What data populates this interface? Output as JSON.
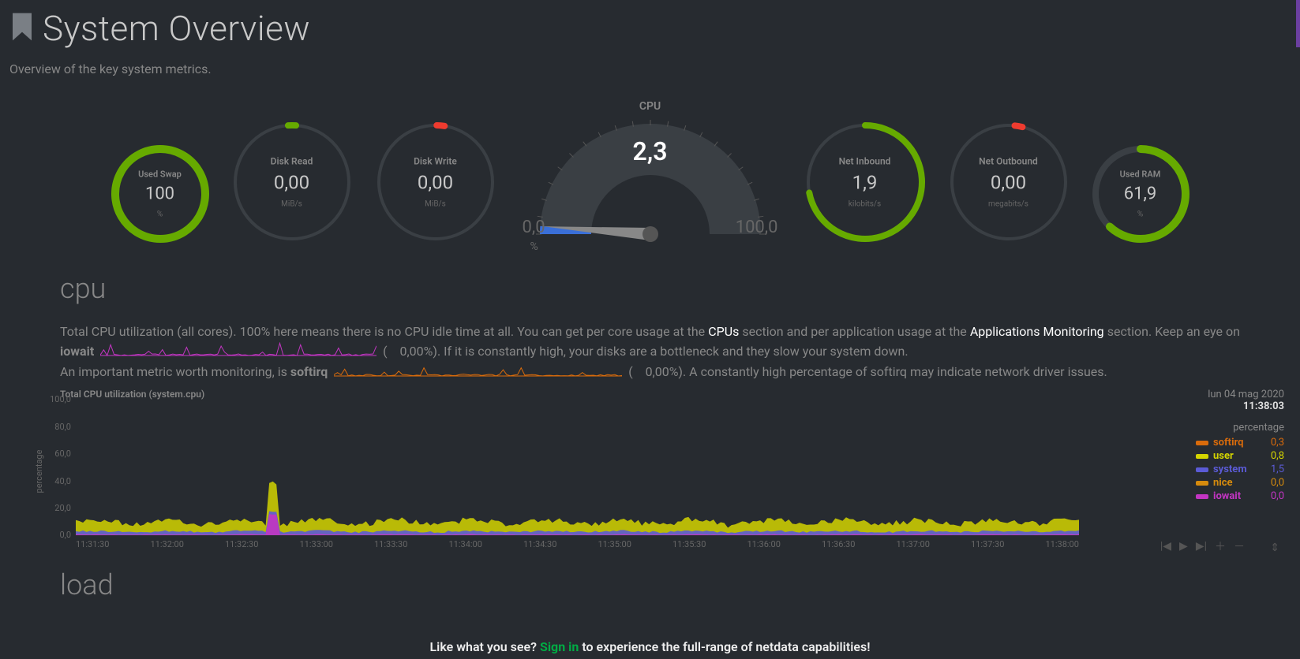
{
  "header": {
    "title": "System Overview",
    "subtitle": "Overview of the key system metrics."
  },
  "gauges": {
    "used_swap": {
      "label": "Used Swap",
      "value": "100",
      "unit": "%",
      "percent": 100,
      "track": "#3a3f44",
      "fill": "#66aa00"
    },
    "disk_read": {
      "label": "Disk Read",
      "value": "0,00",
      "unit": "MiB/s",
      "percent": 0,
      "indicator_deg": 0,
      "indicator_color": "#66aa00",
      "track": "#3a3f44"
    },
    "disk_write": {
      "label": "Disk Write",
      "value": "0,00",
      "unit": "MiB/s",
      "percent": 0,
      "indicator_deg": 5,
      "indicator_color": "#ee3b2f",
      "track": "#3a3f44"
    },
    "net_in": {
      "label": "Net Inbound",
      "value": "1,9",
      "unit": "kilobits/s",
      "percent": 72,
      "fill": "#66aa00",
      "track": "#3a3f44"
    },
    "net_out": {
      "label": "Net Outbound",
      "value": "0,00",
      "unit": "megabits/s",
      "percent": 0,
      "indicator_deg": 10,
      "indicator_color": "#ee3b2f",
      "track": "#3a3f44"
    },
    "used_ram": {
      "label": "Used RAM",
      "value": "61,9",
      "unit": "%",
      "percent": 62,
      "fill": "#66aa00",
      "track": "#3a3f44"
    },
    "cpu": {
      "title": "CPU",
      "value": "2,3",
      "min": "0,0",
      "max": "100,0",
      "unit": "%",
      "needle_percent": 2.3
    }
  },
  "cpu_section": {
    "heading": "cpu",
    "text_pre": "Total CPU utilization (all cores). 100% here means there is no CPU idle time at all. You can get per core usage at the ",
    "link_cpus": "CPUs",
    "text_mid1": " section and per application usage at the ",
    "link_apps": "Applications Monitoring",
    "text_mid2": " section. Keep an eye on ",
    "iowait_label": "iowait",
    "iowait_value": "0,00%",
    "text_mid3": "). If it is constantly high, your disks are a bottleneck and they slow your system down.",
    "text_line3_pre": "An important metric worth monitoring, is ",
    "softirq_label": "softirq",
    "softirq_value": "0,00%",
    "text_line3_post": "). A constantly high percentage of softirq may indicate network driver issues."
  },
  "chart_data": {
    "type": "area",
    "title": "Total CPU utilization (system.cpu)",
    "xlabel": "",
    "ylabel": "percentage",
    "ylim": [
      0,
      100
    ],
    "yticks": [
      0,
      20,
      40,
      60,
      80,
      100
    ],
    "x_ticks": [
      "11:31:30",
      "11:32:00",
      "11:32:30",
      "11:33:00",
      "11:33:30",
      "11:34:00",
      "11:34:30",
      "11:35:00",
      "11:35:30",
      "11:36:00",
      "11:36:30",
      "11:37:00",
      "11:37:30",
      "11:38:00"
    ],
    "timestamp_date": "lun 04 mag 2020",
    "timestamp_time": "11:38:03",
    "legend_head": "percentage",
    "series": [
      {
        "name": "softirq",
        "color": "#d96b0b",
        "value": "0,3",
        "values": [
          0.3,
          0.2,
          0.3,
          0.4,
          0.3,
          0.3,
          0.2,
          0.3,
          0.3,
          0.4,
          0.3,
          0.2,
          0.3,
          0.3
        ]
      },
      {
        "name": "user",
        "color": "#d4d400",
        "value": "0,8",
        "values": [
          5,
          6,
          7,
          8,
          6,
          5,
          6,
          7,
          6,
          5,
          6,
          7,
          5,
          4
        ]
      },
      {
        "name": "system",
        "color": "#5b5bd6",
        "value": "1,5",
        "values": [
          2,
          3,
          2.5,
          3,
          2,
          2.5,
          3,
          2,
          2.5,
          3,
          2,
          2.5,
          2,
          2
        ]
      },
      {
        "name": "nice",
        "color": "#d68b0d",
        "value": "0,0",
        "values": [
          0,
          0,
          0,
          0,
          0,
          0,
          0,
          0,
          0,
          0,
          0,
          0,
          0,
          0
        ]
      },
      {
        "name": "iowait",
        "color": "#c235c2",
        "value": "0,0",
        "values": [
          0.2,
          0.1,
          0.3,
          0.2,
          0.1,
          0.2,
          0.3,
          0.1,
          0.2,
          0.1,
          0.3,
          0.2,
          0.1,
          0.1
        ]
      }
    ],
    "spike": {
      "x_index": 2.4,
      "height": 22
    }
  },
  "load_section": {
    "heading": "load"
  },
  "footer": {
    "pre": "Like what you see? ",
    "link": "Sign in",
    "post": " to experience the full-range of netdata capabilities!"
  }
}
